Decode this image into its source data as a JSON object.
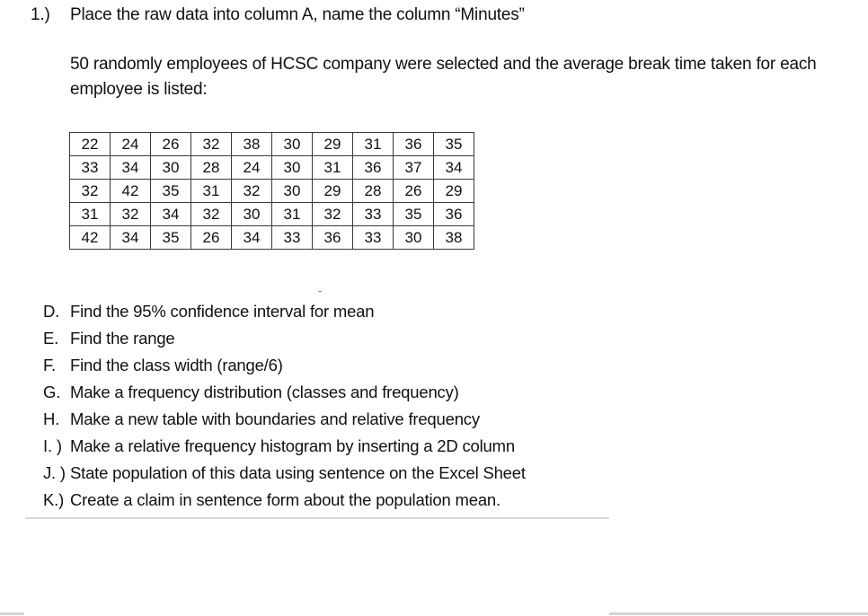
{
  "question": {
    "number": "1.)",
    "title": "Place the raw data into column A, name the column “Minutes”"
  },
  "intro": "50 randomly employees of HCSC company were selected and the average break time taken for each employee is listed:",
  "data_table": {
    "rows": [
      [
        "22",
        "24",
        "26",
        "32",
        "38",
        "30",
        "29",
        "31",
        "36",
        "35"
      ],
      [
        "33",
        "34",
        "30",
        "28",
        "24",
        "30",
        "31",
        "36",
        "37",
        "34"
      ],
      [
        "32",
        "42",
        "35",
        "31",
        "32",
        "30",
        "29",
        "28",
        "26",
        "29"
      ],
      [
        "31",
        "32",
        "34",
        "32",
        "30",
        "31",
        "32",
        "33",
        "35",
        "36"
      ],
      [
        "42",
        "34",
        "35",
        "26",
        "34",
        "33",
        "36",
        "33",
        "30",
        "38"
      ]
    ]
  },
  "tasks": [
    {
      "letter": "D.",
      "text": "Find the 95% confidence interval for mean"
    },
    {
      "letter": "E.",
      "text": "Find the range"
    },
    {
      "letter": "F.",
      "text": "Find the class width (range/6)"
    },
    {
      "letter": "G.",
      "text": "Make a frequency distribution (classes and frequency)"
    },
    {
      "letter": "H.",
      "text": "Make a new table with boundaries and relative frequency"
    },
    {
      "letter": "I. )",
      "text": "Make a relative frequency histogram by inserting a 2D column"
    },
    {
      "letter": "J. )",
      "text": "State population of this data using sentence on the Excel Sheet"
    },
    {
      "letter": "K.)",
      "text": "Create a claim in sentence form about the population mean."
    }
  ]
}
